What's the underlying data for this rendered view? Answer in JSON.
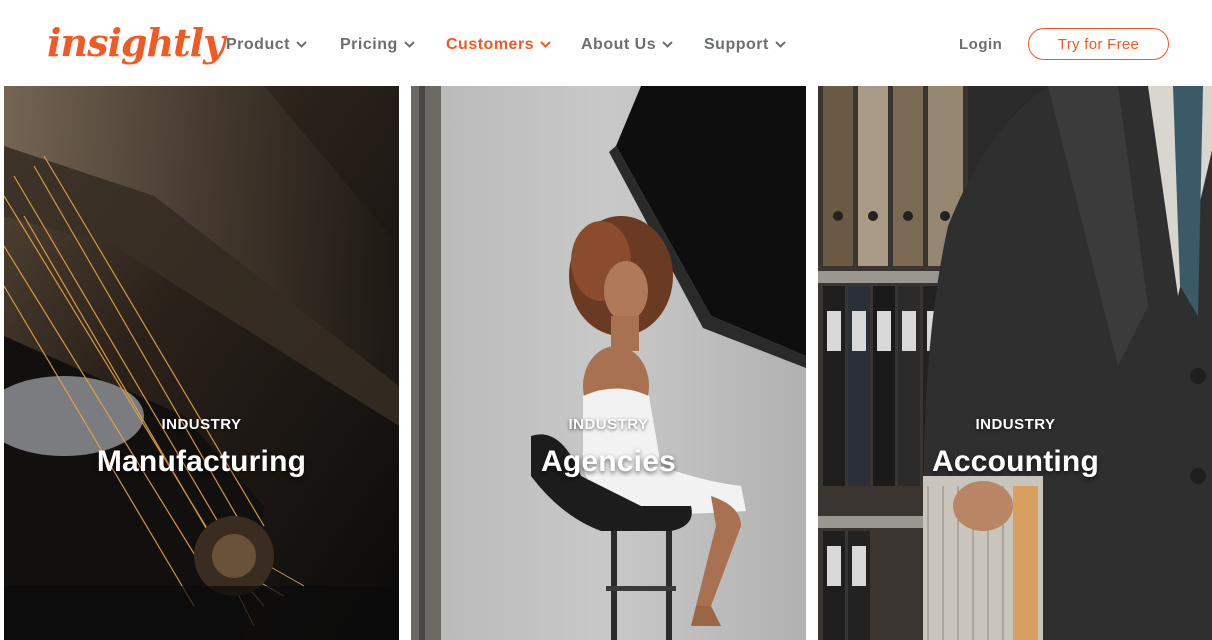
{
  "brand": {
    "name": "insightly",
    "color": "#f15a22"
  },
  "nav": {
    "items": [
      {
        "label": "Product",
        "active": false
      },
      {
        "label": "Pricing",
        "active": false
      },
      {
        "label": "Customers",
        "active": true
      },
      {
        "label": "About Us",
        "active": false
      },
      {
        "label": "Support",
        "active": false
      }
    ],
    "login_label": "Login",
    "cta_label": "Try for Free"
  },
  "cards": [
    {
      "eyebrow": "INDUSTRY",
      "title": "Manufacturing",
      "image": "angle-grinder-sparks-photo"
    },
    {
      "eyebrow": "INDUSTRY",
      "title": "Agencies",
      "image": "woman-on-stool-studio-photo"
    },
    {
      "eyebrow": "INDUSTRY",
      "title": "Accounting",
      "image": "man-in-suit-with-files-photo"
    }
  ],
  "colors": {
    "nav_text": "#6b6f72",
    "accent": "#f15a22"
  }
}
